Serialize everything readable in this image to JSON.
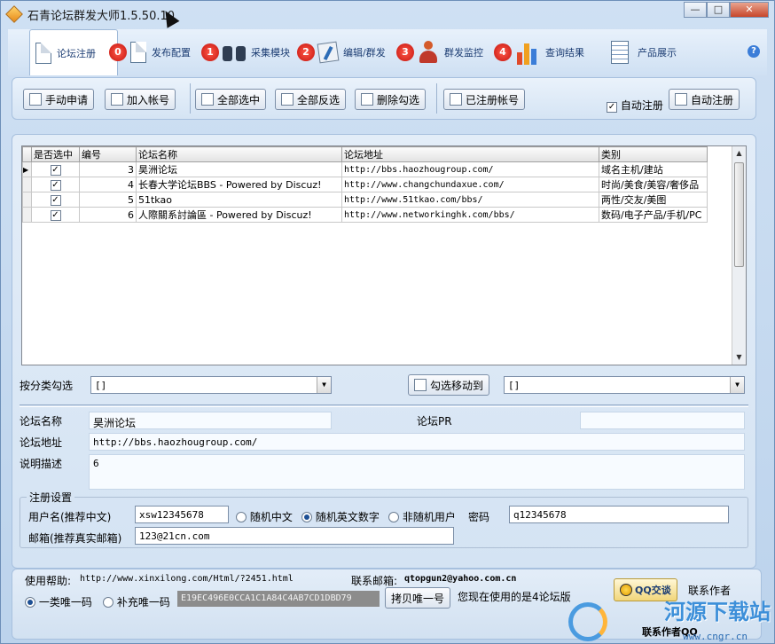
{
  "window": {
    "title": "石青论坛群发大师1.5.50.10",
    "minimize": "—",
    "maximize": "□",
    "close": "✕"
  },
  "tabs": [
    {
      "label": "论坛注册",
      "badge": "0",
      "icon": "document-icon"
    },
    {
      "label": "发布配置",
      "badge": "1",
      "icon": "document-icon"
    },
    {
      "label": "采集模块",
      "badge": "2",
      "icon": "binoculars-icon"
    },
    {
      "label": "编辑/群发",
      "badge": "3",
      "icon": "edit-icon"
    },
    {
      "label": "群发监控",
      "badge": "4",
      "icon": "user-icon"
    },
    {
      "label": "查询结果",
      "badge": "",
      "icon": "bar-chart-icon"
    },
    {
      "label": "产品展示",
      "badge": "",
      "icon": "product-icon"
    }
  ],
  "help": "?",
  "toolbar": {
    "manual_apply": "手动申请",
    "add_account": "加入帐号",
    "select_all": "全部选中",
    "invert_select": "全部反选",
    "delete_checked": "删除勾选",
    "registered_accounts": "已注册帐号",
    "auto_register_check": "自动注册",
    "auto_register_btn": "自动注册"
  },
  "grid": {
    "columns": [
      "是否选中",
      "编号",
      "论坛名称",
      "论坛地址",
      "类别"
    ],
    "rows": [
      {
        "checked": "✓",
        "id": "3",
        "name": "昊洲论坛",
        "url": "http://bbs.haozhougroup.com/",
        "category": "域名主机/建站"
      },
      {
        "checked": "✓",
        "id": "4",
        "name": "长春大学论坛BBS - Powered by Discuz!",
        "url": "http://www.changchundaxue.com/",
        "category": "时尚/美食/美容/奢侈品"
      },
      {
        "checked": "✓",
        "id": "5",
        "name": "51tkao",
        "url": "http://www.51tkao.com/bbs/",
        "category": "两性/交友/美图"
      },
      {
        "checked": "✓",
        "id": "6",
        "name": "人際關系討論區 - Powered by Discuz!",
        "url": "http://www.networkinghk.com/bbs/",
        "category": "数码/电子产品/手机/PC"
      }
    ]
  },
  "filter": {
    "category_label": "按分类勾选",
    "category_value": "[]",
    "move_button": "勾选移动到",
    "move_value": "[]"
  },
  "details": {
    "name_label": "论坛名称",
    "name_value": "昊洲论坛",
    "pr_label": "论坛PR",
    "pr_value": "",
    "url_label": "论坛地址",
    "url_value": "http://bbs.haozhougroup.com/",
    "desc_label": "说明描述",
    "desc_value": "6"
  },
  "register": {
    "legend": "注册设置",
    "username_label": "用户名(推荐中文)",
    "username_value": "xsw12345678",
    "opt_random_cn": "随机中文",
    "opt_random_en": "随机英文数字",
    "opt_fixed": "非随机用户",
    "password_label": "密码",
    "password_value": "q12345678",
    "email_label": "邮箱(推荐真实邮箱)",
    "email_value": "123@21cn.com"
  },
  "status": {
    "help_label": "使用帮助:",
    "help_url": "http://www.xinxilong.com/Html/?2451.html",
    "email_label": "联系邮箱:",
    "email_value": "qtopgun2@yahoo.com.cn",
    "opt_unique_1": "一类唯一码",
    "opt_unique_2": "补充唯一码",
    "code": "E19EC496E0CCA1C1A84C4AB7CD1DBD79",
    "copy_button": "拷贝唯一号",
    "version_text": "您现在使用的是4论坛版",
    "qq_button": "QQ交谈",
    "contact_author": "联系作者",
    "contact_qq": "联系作者QQ"
  },
  "watermark": {
    "text": "河源下载站",
    "url": "www.cngr.cn"
  },
  "colors": {
    "accent": "#1c3d73",
    "badge": "#d91b12",
    "panel": "#d4e3f3"
  }
}
